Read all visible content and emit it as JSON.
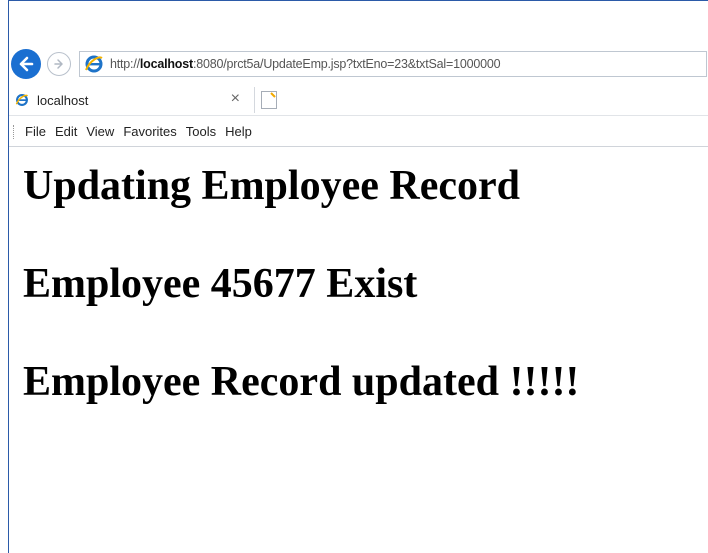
{
  "browser": {
    "url_prefix": "http://",
    "url_host": "localhost",
    "url_rest": ":8080/prct5a/UpdateEmp.jsp?txtEno=23&txtSal=1000000",
    "tab_title": "localhost",
    "tab_close": "×",
    "menu": [
      "File",
      "Edit",
      "View",
      "Favorites",
      "Tools",
      "Help"
    ],
    "back_color": "#1a6fd1"
  },
  "page": {
    "heading1": "Updating Employee Record",
    "heading2": "Employee 45677 Exist",
    "heading3": "Employee Record updated !!!!!"
  }
}
